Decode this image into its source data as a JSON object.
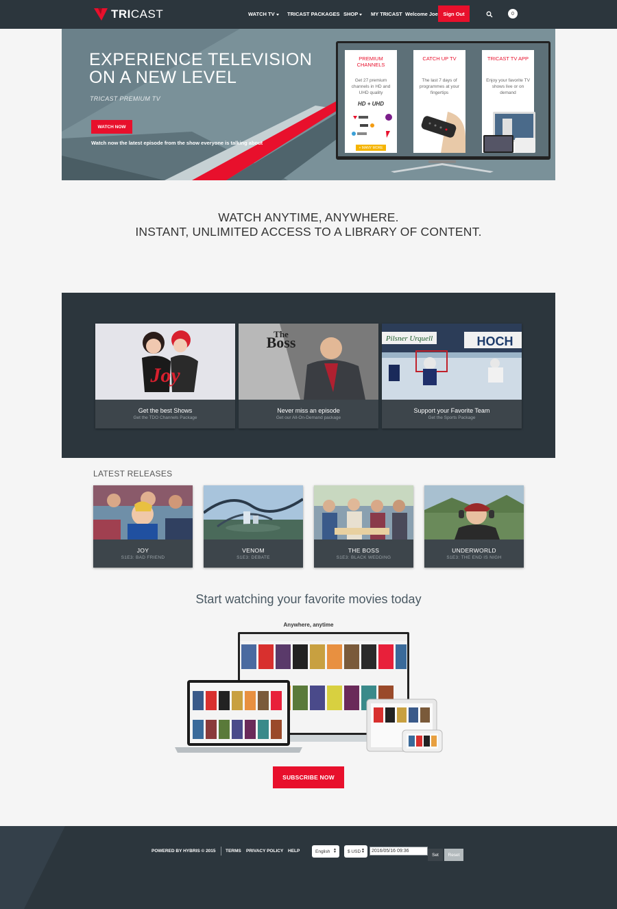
{
  "brand": {
    "name_bold": "TRI",
    "name_light": "CAST",
    "accent": "#e8102c",
    "dark": "#2c363d"
  },
  "nav": {
    "watch_tv": "WATCH TV",
    "packages": "TRICAST PACKAGES",
    "shop": "SHOP",
    "my_tricast": "MY TRICAST",
    "welcome": "Welcome Joe",
    "sign_out": "Sign Out",
    "cart_count": "0"
  },
  "hero": {
    "title": "EXPERIENCE TELEVISION ON A NEW LEVEL",
    "subtitle": "TRICAST PREMIUM TV",
    "cta": "WATCH NOW",
    "caption": "Watch now the latest episode from the show everyone is talking about",
    "cards": [
      {
        "title": "PREMIUM CHANNELS",
        "text": "Get 27 premium channels in HD and UHD quality",
        "badge": "HD + UHD",
        "more": "+ MANY MORE"
      },
      {
        "title": "CATCH UP TV",
        "text": "The last 7 days of programmes at your fingertips"
      },
      {
        "title": "TRICAST TV APP",
        "text": "Enjoy your favorite TV shows live or on demand"
      }
    ]
  },
  "tagline": {
    "line1": "WATCH ANYTIME, ANYWHERE.",
    "line2": "INSTANT, UNLIMITED ACCESS TO A LIBRARY OF CONTENT."
  },
  "promos": [
    {
      "title": "Get the best Shows",
      "sub": "Get the TDO Channels Package",
      "image_text": "Joy"
    },
    {
      "title": "Never miss an episode",
      "sub": "Get our All-On-Demand package",
      "image_text_1": "The",
      "image_text_2": "Boss"
    },
    {
      "title": "Support your Favorite Team",
      "sub": "Get the Sports Package",
      "image_text_1": "Pilsner Urquell",
      "image_text_2": "HOCH"
    }
  ],
  "latest": {
    "heading": "LATEST RELEASES",
    "items": [
      {
        "title": "JOY",
        "sub": "S1E3: BAD FRIEND"
      },
      {
        "title": "VENOM",
        "sub": "S1E3: DEBATE"
      },
      {
        "title": "THE BOSS",
        "sub": "S1E3: BLACK WEDDING"
      },
      {
        "title": "UNDERWORLD",
        "sub": "S1E3: THE END IS NIGH"
      }
    ]
  },
  "start": {
    "heading": "Start watching your favorite movies today",
    "anywhere": "Anywhere, anytime",
    "cta": "SUBSCRIBE NOW"
  },
  "footer": {
    "powered": "POWERED BY HYBRIS © 2015",
    "terms": "TERMS",
    "privacy": "PRIVACY POLICY",
    "help": "HELP",
    "language": "English",
    "currency": "$ USD",
    "datetime": "2016/05/16 09:36",
    "set": "Set",
    "reset": "Reset"
  }
}
